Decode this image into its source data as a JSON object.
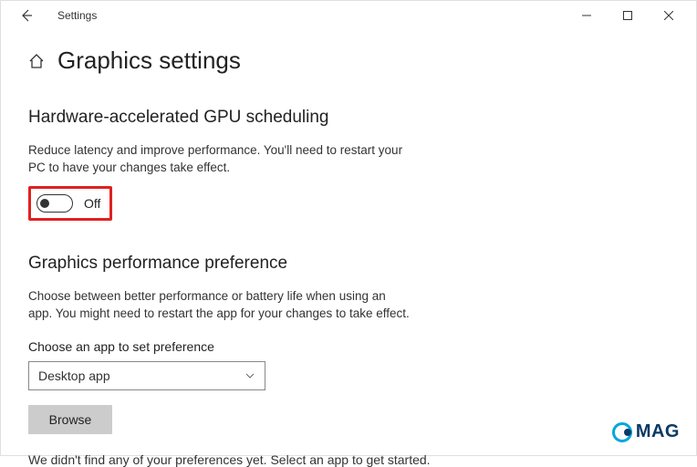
{
  "titlebar": {
    "app_title": "Settings"
  },
  "page": {
    "title": "Graphics settings"
  },
  "gpu_scheduling": {
    "heading": "Hardware-accelerated GPU scheduling",
    "description": "Reduce latency and improve performance. You'll need to restart your PC to have your changes take effect.",
    "toggle_state": "Off"
  },
  "perf_pref": {
    "heading": "Graphics performance preference",
    "description": "Choose between better performance or battery life when using an app. You might need to restart the app for your changes to take effect.",
    "choose_label": "Choose an app to set preference",
    "dropdown_selected": "Desktop app",
    "browse_label": "Browse",
    "empty_msg": "We didn't find any of your preferences yet. Select an app to get started."
  },
  "watermark": {
    "text": "MAG"
  }
}
